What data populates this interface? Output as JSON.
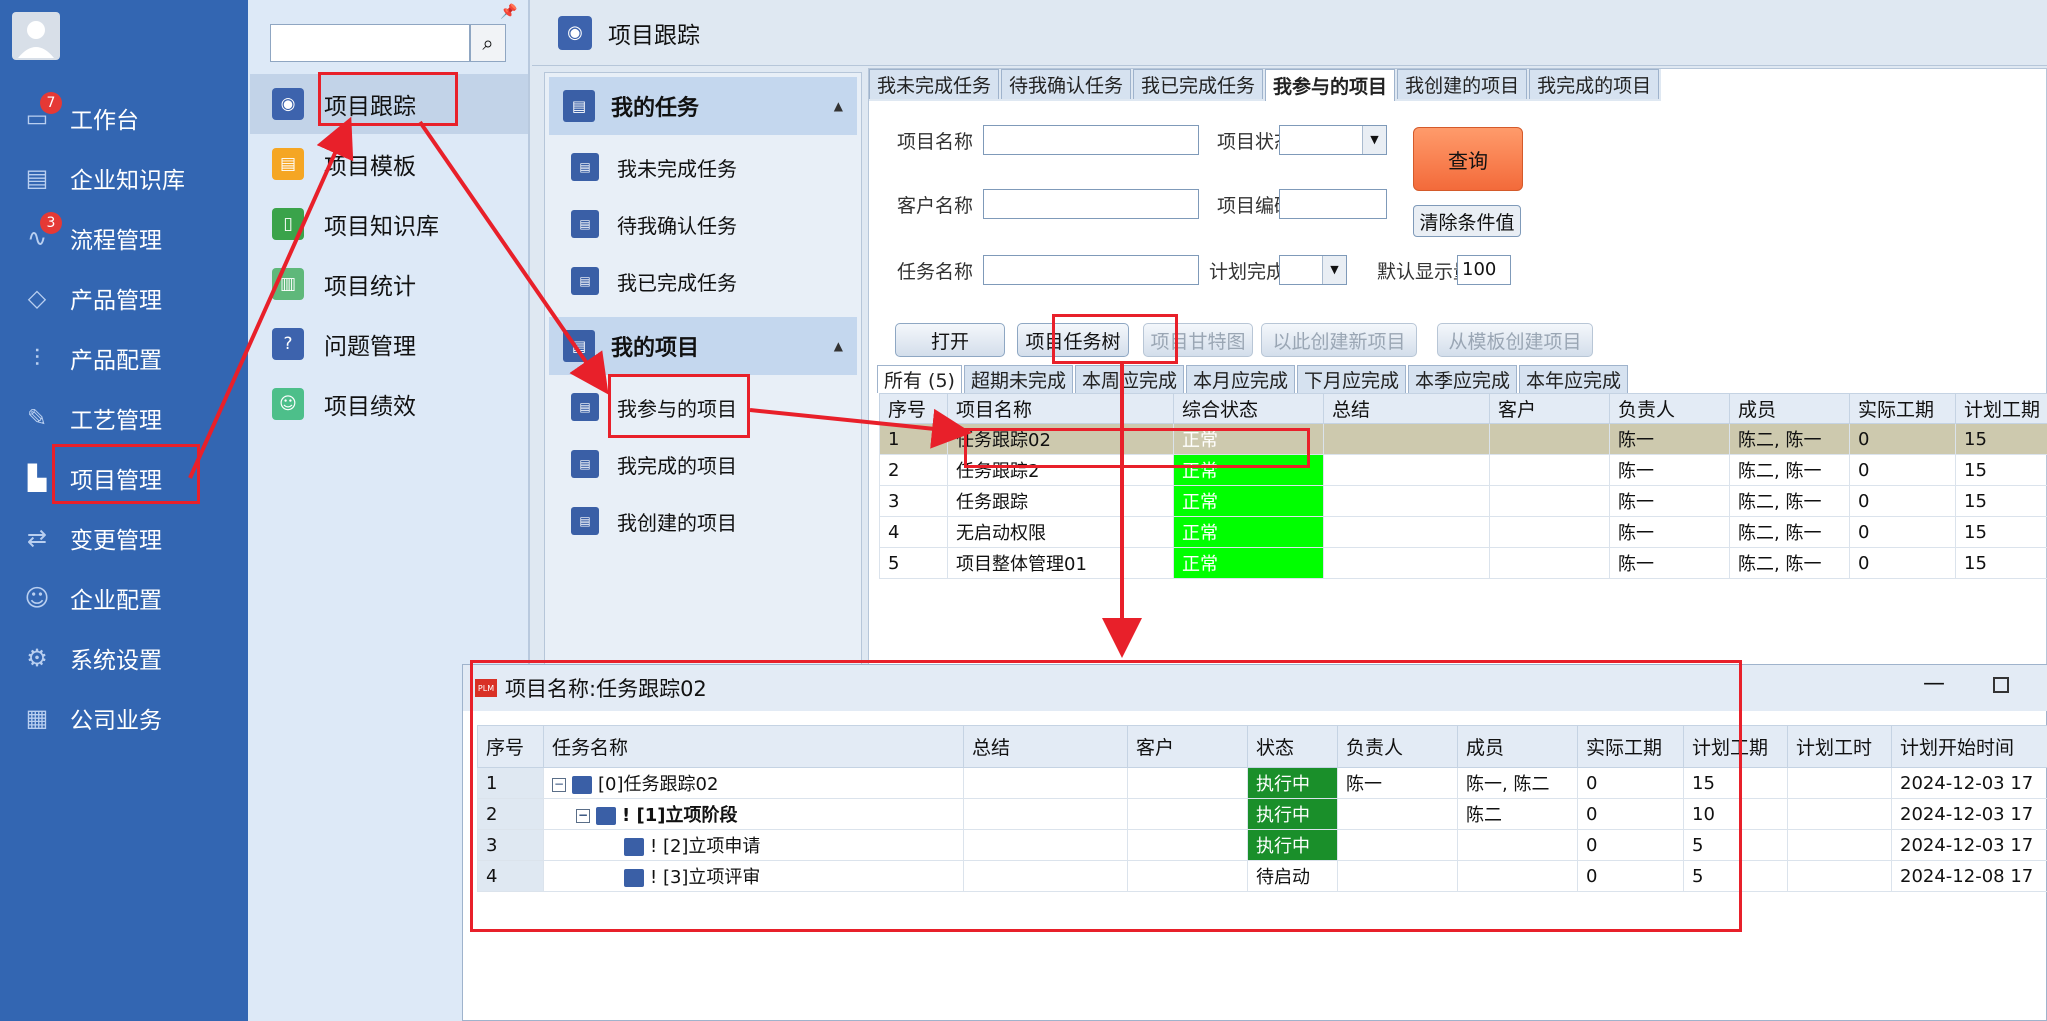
{
  "nav": {
    "items": [
      {
        "label": "工作台",
        "icon": "monitor-icon",
        "badge": "7"
      },
      {
        "label": "企业知识库",
        "icon": "book-icon",
        "badge": ""
      },
      {
        "label": "流程管理",
        "icon": "flow-icon",
        "badge": "3"
      },
      {
        "label": "产品管理",
        "icon": "cube-icon",
        "badge": ""
      },
      {
        "label": "产品配置",
        "icon": "sliders-icon",
        "badge": ""
      },
      {
        "label": "工艺管理",
        "icon": "wrench-icon",
        "badge": ""
      },
      {
        "label": "项目管理",
        "icon": "chart-icon",
        "badge": ""
      },
      {
        "label": "变更管理",
        "icon": "change-icon",
        "badge": ""
      },
      {
        "label": "企业配置",
        "icon": "users-icon",
        "badge": ""
      },
      {
        "label": "系统设置",
        "icon": "gear-icon",
        "badge": ""
      },
      {
        "label": "公司业务",
        "icon": "grid-icon",
        "badge": ""
      }
    ]
  },
  "sub": {
    "search_value": "",
    "items": [
      {
        "label": "项目跟踪",
        "color": "#3d63ad"
      },
      {
        "label": "项目模板",
        "color": "#f5a623"
      },
      {
        "label": "项目知识库",
        "color": "#3aa34a"
      },
      {
        "label": "项目统计",
        "color": "#5fb87a"
      },
      {
        "label": "问题管理",
        "color": "#3d63ad"
      },
      {
        "label": "项目绩效",
        "color": "#4dbf8a"
      }
    ]
  },
  "main": {
    "title": "项目跟踪",
    "task_group": "我的任务",
    "task_items": [
      "我未完成任务",
      "待我确认任务",
      "我已完成任务"
    ],
    "project_group": "我的项目",
    "project_items": [
      "我参与的项目",
      "我完成的项目",
      "我创建的项目"
    ],
    "tabs": [
      "我未完成任务",
      "待我确认任务",
      "我已完成任务",
      "我参与的项目",
      "我创建的项目",
      "我完成的项目"
    ],
    "form": {
      "project_name": "项目名称",
      "project_status": "项目状态",
      "customer_name": "客户名称",
      "project_code": "项目编码",
      "task_name": "任务名称",
      "plan_year": "计划完成年",
      "default_count_label": "默认显示量",
      "default_count_value": "100",
      "query": "查询",
      "clear": "清除条件值"
    },
    "actions": [
      "打开",
      "项目任务树",
      "项目甘特图",
      "以此创建新项目",
      "从模板创建项目"
    ],
    "filter_tabs": [
      "所有 (5)",
      "超期未完成",
      "本周应完成",
      "本月应完成",
      "下月应完成",
      "本季应完成",
      "本年应完成"
    ],
    "table": {
      "headers": [
        "序号",
        "项目名称",
        "综合状态",
        "总结",
        "客户",
        "负责人",
        "成员",
        "实际工期",
        "计划工期"
      ],
      "rows": [
        [
          "1",
          "任务跟踪02",
          "正常",
          "",
          "",
          "陈一",
          "陈二, 陈一",
          "0",
          "15"
        ],
        [
          "2",
          "任务跟踪2",
          "正常",
          "",
          "",
          "陈一",
          "陈二, 陈一",
          "0",
          "15"
        ],
        [
          "3",
          "任务跟踪",
          "正常",
          "",
          "",
          "陈一",
          "陈二, 陈一",
          "0",
          "15"
        ],
        [
          "4",
          "无启动权限",
          "正常",
          "",
          "",
          "陈一",
          "陈二, 陈一",
          "0",
          "15"
        ],
        [
          "5",
          "项目整体管理01",
          "正常",
          "",
          "",
          "陈一",
          "陈二, 陈一",
          "0",
          "15"
        ]
      ]
    }
  },
  "popup": {
    "logo": "PLM",
    "title": "项目名称:任务跟踪02",
    "min": "—",
    "headers": [
      "序号",
      "任务名称",
      "总结",
      "客户",
      "状态",
      "负责人",
      "成员",
      "实际工期",
      "计划工期",
      "计划工时",
      "计划开始时间"
    ],
    "rows": [
      [
        "1",
        "[0]任务跟踪02",
        "",
        "",
        "执行中",
        "陈一",
        "陈一, 陈二",
        "0",
        "15",
        "",
        "2024-12-03 17"
      ],
      [
        "2",
        "! [1]立项阶段",
        "",
        "",
        "执行中",
        "",
        "陈二",
        "0",
        "10",
        "",
        "2024-12-03 17"
      ],
      [
        "3",
        "! [2]立项申请",
        "",
        "",
        "执行中",
        "",
        "",
        "0",
        "5",
        "",
        "2024-12-03 17"
      ],
      [
        "4",
        "! [3]立项评审",
        "",
        "",
        "待启动",
        "",
        "",
        "0",
        "5",
        "",
        "2024-12-08 17"
      ]
    ]
  },
  "colors": {
    "nav": "#3366b2",
    "highlight": "#e8202a",
    "status_ok": "#00ff00",
    "status_run": "#1a8f2a"
  }
}
